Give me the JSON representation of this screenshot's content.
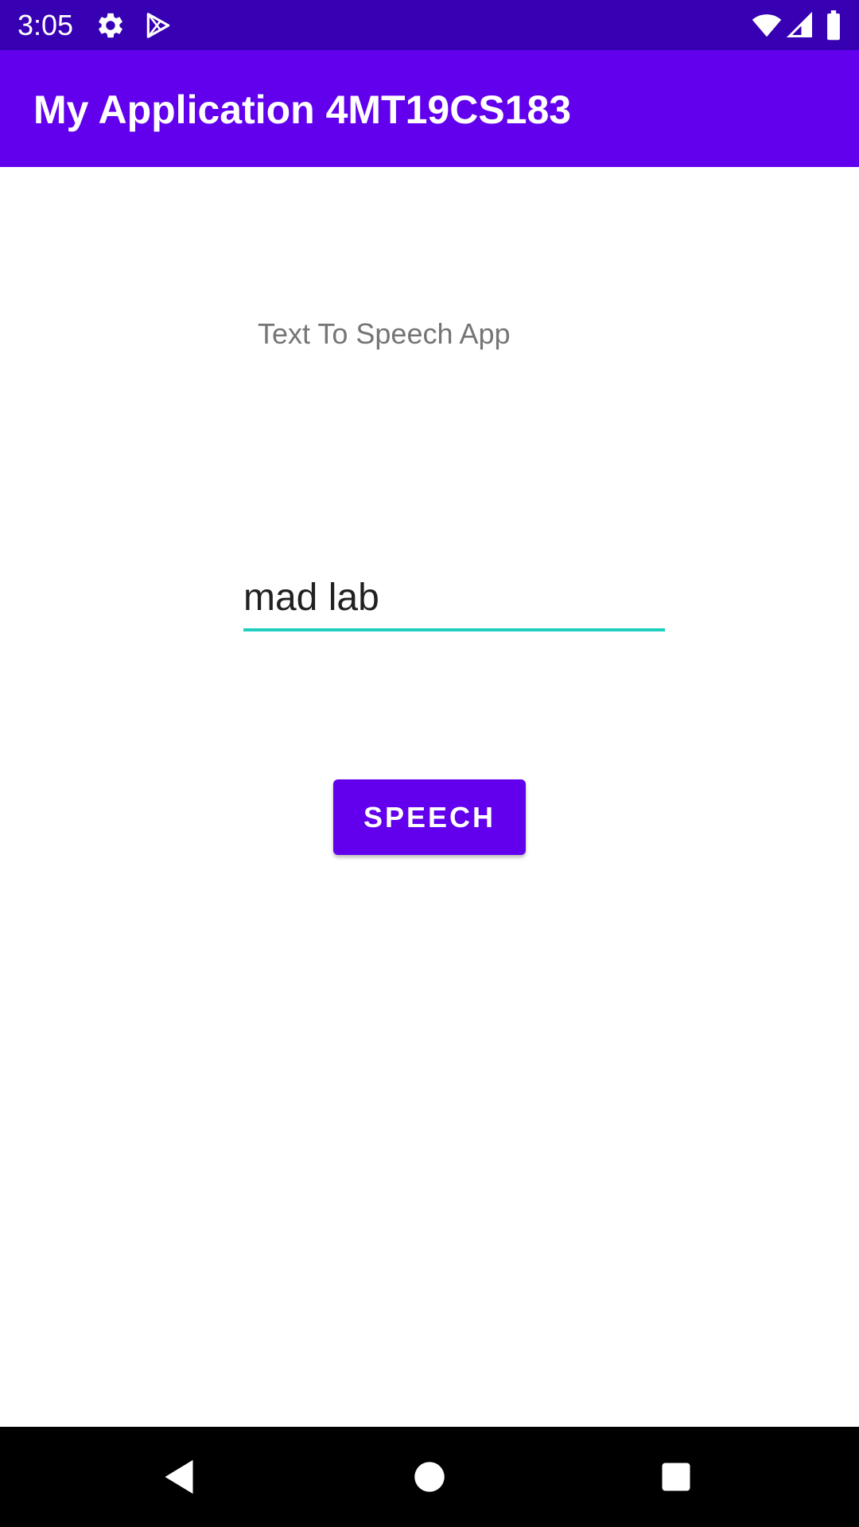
{
  "status_bar": {
    "time": "3:05",
    "icons": [
      "settings-icon",
      "play-store-icon",
      "wifi-icon",
      "signal-icon",
      "battery-icon"
    ]
  },
  "app_bar": {
    "title": "My Application 4MT19CS183"
  },
  "main": {
    "heading": "Text To Speech App",
    "input_value": "mad lab",
    "button_label": "SPEECH"
  },
  "nav_bar": {
    "icons": [
      "back-icon",
      "home-icon",
      "recents-icon"
    ]
  },
  "colors": {
    "status_bar": "#3700b3",
    "primary": "#6200ee",
    "input_accent": "#1fcfc0",
    "nav_bar": "#000000"
  }
}
